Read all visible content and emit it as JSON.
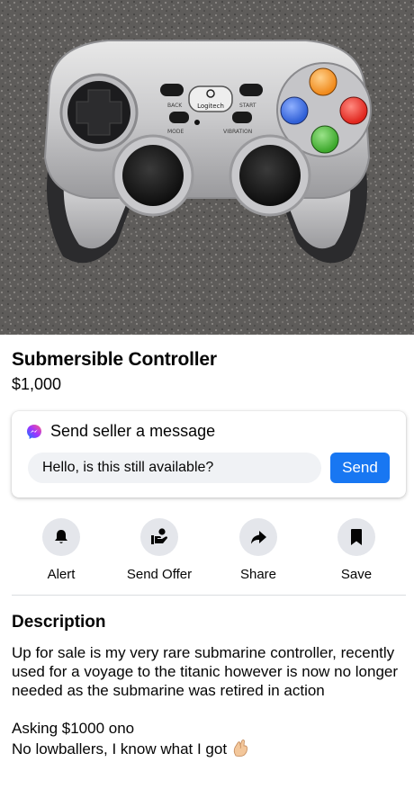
{
  "listing": {
    "title": "Submersible Controller",
    "price": "$1,000"
  },
  "photo": {
    "subject": "game-controller-photo",
    "brand_text": "Logitech",
    "button_labels": [
      "BACK",
      "START",
      "MODE",
      "VIBRATION"
    ]
  },
  "message": {
    "heading": "Send seller a message",
    "input_value": "Hello, is this still available?",
    "send_label": "Send",
    "icon": "messenger-icon"
  },
  "actions": [
    {
      "label": "Alert",
      "icon": "bell-icon"
    },
    {
      "label": "Send Offer",
      "icon": "offer-icon"
    },
    {
      "label": "Share",
      "icon": "share-arrow-icon"
    },
    {
      "label": "Save",
      "icon": "bookmark-icon"
    }
  ],
  "description": {
    "heading": "Description",
    "paragraphs": [
      "Up for sale is my very rare submarine controller, recently used for a voyage to the titanic however is now no longer needed as the submarine was retired in action",
      "Asking $1000 ono\nNo lowballers, I know what I got"
    ],
    "trailing_emoji": "pinched-fingers-emoji"
  },
  "colors": {
    "accent": "#1877f2",
    "action_circle": "#e4e6eb",
    "input_bg": "#f0f2f5",
    "button_orange": "#f08a1c",
    "button_blue": "#2f5fd6",
    "button_red": "#e0261e",
    "button_green": "#3da82c"
  }
}
